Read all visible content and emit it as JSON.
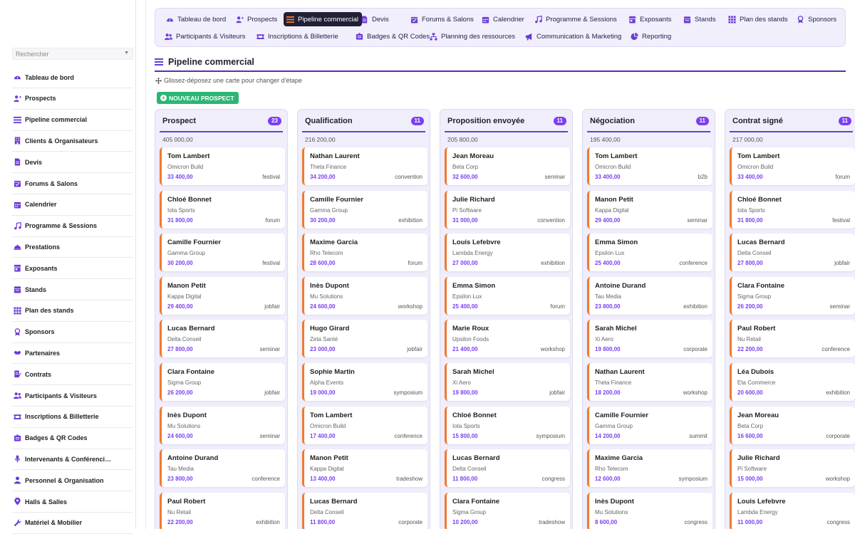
{
  "search": {
    "placeholder": "Rechercher"
  },
  "sidebar": {
    "items": [
      {
        "label": "Tableau de bord",
        "icon": "dashboard-icon"
      },
      {
        "label": "Prospects",
        "icon": "user-plus-icon"
      },
      {
        "label": "Pipeline commercial",
        "icon": "pipeline-icon"
      },
      {
        "label": "Clients & Organisateurs",
        "icon": "building-icon"
      },
      {
        "label": "Devis",
        "icon": "file-icon"
      },
      {
        "label": "Forums & Salons",
        "icon": "calendar-check-icon"
      },
      {
        "label": "Calendrier",
        "icon": "calendar-icon"
      },
      {
        "label": "Programme & Sessions",
        "icon": "music-icon"
      },
      {
        "label": "Prestations",
        "icon": "service-icon"
      },
      {
        "label": "Exposants",
        "icon": "store-icon"
      },
      {
        "label": "Stands",
        "icon": "stand-icon"
      },
      {
        "label": "Plan des stands",
        "icon": "grid-icon"
      },
      {
        "label": "Sponsors",
        "icon": "award-icon"
      },
      {
        "label": "Partenaires",
        "icon": "handshake-icon"
      },
      {
        "label": "Contrats",
        "icon": "contract-icon"
      },
      {
        "label": "Participants & Visiteurs",
        "icon": "users-icon"
      },
      {
        "label": "Inscriptions & Billetterie",
        "icon": "ticket-icon"
      },
      {
        "label": "Badges & QR Codes",
        "icon": "badge-icon"
      },
      {
        "label": "Intervenants & Conférenci…",
        "icon": "microphone-icon"
      },
      {
        "label": "Personnel & Organisation",
        "icon": "person-icon"
      },
      {
        "label": "Halls & Salles",
        "icon": "location-icon"
      },
      {
        "label": "Matériel & Mobilier",
        "icon": "wrench-icon"
      }
    ]
  },
  "topnav": {
    "tabs": [
      {
        "label": "Tableau de bord",
        "icon": "dashboard-icon",
        "active": false
      },
      {
        "label": "Prospects",
        "icon": "user-plus-icon",
        "active": false
      },
      {
        "label": "Pipeline commercial",
        "icon": "pipeline-icon",
        "active": true
      },
      {
        "label": "Devis",
        "icon": "file-icon",
        "active": false
      },
      {
        "label": "Forums & Salons",
        "icon": "calendar-check-icon",
        "active": false
      },
      {
        "label": "Calendrier",
        "icon": "calendar-icon",
        "active": false
      },
      {
        "label": "Programme & Sessions",
        "icon": "music-icon",
        "active": false
      },
      {
        "label": "Exposants",
        "icon": "store-icon",
        "active": false
      },
      {
        "label": "Stands",
        "icon": "stand-icon",
        "active": false
      },
      {
        "label": "Plan des stands",
        "icon": "grid-icon",
        "active": false
      },
      {
        "label": "Sponsors",
        "icon": "award-icon",
        "active": false
      },
      {
        "label": "Participants & Visiteurs",
        "icon": "users-icon",
        "active": false
      },
      {
        "label": "Inscriptions & Billetterie",
        "icon": "ticket-icon",
        "active": false
      },
      {
        "label": "Badges & QR Codes",
        "icon": "badge-icon",
        "active": false
      },
      {
        "label": "Planning des ressources",
        "icon": "sitemap-icon",
        "active": false
      },
      {
        "label": "Communication & Marketing",
        "icon": "megaphone-icon",
        "active": false
      },
      {
        "label": "Reporting",
        "icon": "pie-chart-icon",
        "active": false
      }
    ]
  },
  "page": {
    "title": "Pipeline commercial",
    "hint": "Glissez-déposez une carte pour changer d'étape",
    "new_button": "NOUVEAU PROSPECT"
  },
  "colors": {
    "accent": "#7b3ff2",
    "card_border": "#f07a2e",
    "new_button": "#2bb673",
    "active_tab": "#1f2035"
  },
  "board": {
    "columns": [
      {
        "title": "Prospect",
        "count": "23",
        "total": "405 000,00",
        "cards": [
          {
            "name": "Tom Lambert",
            "company": "Omicron Build",
            "amount": "33 400,00",
            "tag": "festival"
          },
          {
            "name": "Chloé Bonnet",
            "company": "Iota Sports",
            "amount": "31 800,00",
            "tag": "forum"
          },
          {
            "name": "Camille Fournier",
            "company": "Gamma Group",
            "amount": "30 200,00",
            "tag": "festival"
          },
          {
            "name": "Manon Petit",
            "company": "Kappa Digital",
            "amount": "29 400,00",
            "tag": "jobfair"
          },
          {
            "name": "Lucas Bernard",
            "company": "Delta Conseil",
            "amount": "27 800,00",
            "tag": "seminar"
          },
          {
            "name": "Clara Fontaine",
            "company": "Sigma Group",
            "amount": "26 200,00",
            "tag": "jobfair"
          },
          {
            "name": "Inès Dupont",
            "company": "Mu Solutions",
            "amount": "24 600,00",
            "tag": "seminar"
          },
          {
            "name": "Antoine Durand",
            "company": "Tau Media",
            "amount": "23 800,00",
            "tag": "conference"
          },
          {
            "name": "Paul Robert",
            "company": "Nu Retail",
            "amount": "22 200,00",
            "tag": "exhibition"
          }
        ]
      },
      {
        "title": "Qualification",
        "count": "11",
        "total": "216 200,00",
        "cards": [
          {
            "name": "Nathan Laurent",
            "company": "Theta Finance",
            "amount": "34 200,00",
            "tag": "convention"
          },
          {
            "name": "Camille Fournier",
            "company": "Gamma Group",
            "amount": "30 200,00",
            "tag": "exhibition"
          },
          {
            "name": "Maxime Garcia",
            "company": "Rho Telecom",
            "amount": "28 600,00",
            "tag": "forum"
          },
          {
            "name": "Inès Dupont",
            "company": "Mu Solutions",
            "amount": "24 600,00",
            "tag": "workshop"
          },
          {
            "name": "Hugo Girard",
            "company": "Zeta Santé",
            "amount": "23 000,00",
            "tag": "jobfair"
          },
          {
            "name": "Sophie Martin",
            "company": "Alpha Events",
            "amount": "19 000,00",
            "tag": "symposium"
          },
          {
            "name": "Tom Lambert",
            "company": "Omicron Build",
            "amount": "17 400,00",
            "tag": "conference"
          },
          {
            "name": "Manon Petit",
            "company": "Kappa Digital",
            "amount": "13 400,00",
            "tag": "tradeshow"
          },
          {
            "name": "Lucas Bernard",
            "company": "Delta Conseil",
            "amount": "11 800,00",
            "tag": "corporate"
          }
        ]
      },
      {
        "title": "Proposition envoyée",
        "count": "11",
        "total": "205 800,00",
        "cards": [
          {
            "name": "Jean Moreau",
            "company": "Beta Corp",
            "amount": "32 600,00",
            "tag": "seminar"
          },
          {
            "name": "Julie Richard",
            "company": "Pi Software",
            "amount": "31 000,00",
            "tag": "convention"
          },
          {
            "name": "Louis Lefebvre",
            "company": "Lambda Energy",
            "amount": "27 000,00",
            "tag": "exhibition"
          },
          {
            "name": "Emma Simon",
            "company": "Epsilon Lux",
            "amount": "25 400,00",
            "tag": "forum"
          },
          {
            "name": "Marie Roux",
            "company": "Upsilon Foods",
            "amount": "21 400,00",
            "tag": "workshop"
          },
          {
            "name": "Sarah Michel",
            "company": "Xi Aero",
            "amount": "19 800,00",
            "tag": "jobfair"
          },
          {
            "name": "Chloé Bonnet",
            "company": "Iota Sports",
            "amount": "15 800,00",
            "tag": "symposium"
          },
          {
            "name": "Lucas Bernard",
            "company": "Delta Conseil",
            "amount": "11 800,00",
            "tag": "congress"
          },
          {
            "name": "Clara Fontaine",
            "company": "Sigma Group",
            "amount": "10 200,00",
            "tag": "tradeshow"
          }
        ]
      },
      {
        "title": "Négociation",
        "count": "11",
        "total": "195 400,00",
        "cards": [
          {
            "name": "Tom Lambert",
            "company": "Omicron Build",
            "amount": "33 400,00",
            "tag": "b2b"
          },
          {
            "name": "Manon Petit",
            "company": "Kappa Digital",
            "amount": "29 400,00",
            "tag": "seminar"
          },
          {
            "name": "Emma Simon",
            "company": "Epsilon Lux",
            "amount": "25 400,00",
            "tag": "conference"
          },
          {
            "name": "Antoine Durand",
            "company": "Tau Media",
            "amount": "23 800,00",
            "tag": "exhibition"
          },
          {
            "name": "Sarah Michel",
            "company": "Xi Aero",
            "amount": "19 800,00",
            "tag": "corporate"
          },
          {
            "name": "Nathan Laurent",
            "company": "Theta Finance",
            "amount": "18 200,00",
            "tag": "workshop"
          },
          {
            "name": "Camille Fournier",
            "company": "Gamma Group",
            "amount": "14 200,00",
            "tag": "summit"
          },
          {
            "name": "Maxime Garcia",
            "company": "Rho Telecom",
            "amount": "12 600,00",
            "tag": "symposium"
          },
          {
            "name": "Inès Dupont",
            "company": "Mu Solutions",
            "amount": "8 600,00",
            "tag": "congress"
          }
        ]
      },
      {
        "title": "Contrat signé",
        "count": "11",
        "total": "217 000,00",
        "cards": [
          {
            "name": "Tom Lambert",
            "company": "Omicron Build",
            "amount": "33 400,00",
            "tag": "forum"
          },
          {
            "name": "Chloé Bonnet",
            "company": "Iota Sports",
            "amount": "31 800,00",
            "tag": "festival"
          },
          {
            "name": "Lucas Bernard",
            "company": "Delta Conseil",
            "amount": "27 800,00",
            "tag": "jobfair"
          },
          {
            "name": "Clara Fontaine",
            "company": "Sigma Group",
            "amount": "26 200,00",
            "tag": "seminar"
          },
          {
            "name": "Paul Robert",
            "company": "Nu Retail",
            "amount": "22 200,00",
            "tag": "conference"
          },
          {
            "name": "Léa Dubois",
            "company": "Eta Commerce",
            "amount": "20 600,00",
            "tag": "exhibition"
          },
          {
            "name": "Jean Moreau",
            "company": "Beta Corp",
            "amount": "16 600,00",
            "tag": "corporate"
          },
          {
            "name": "Julie Richard",
            "company": "Pi Software",
            "amount": "15 000,00",
            "tag": "workshop"
          },
          {
            "name": "Louis Lefebvre",
            "company": "Lambda Energy",
            "amount": "11 000,00",
            "tag": "congress"
          }
        ]
      }
    ]
  }
}
